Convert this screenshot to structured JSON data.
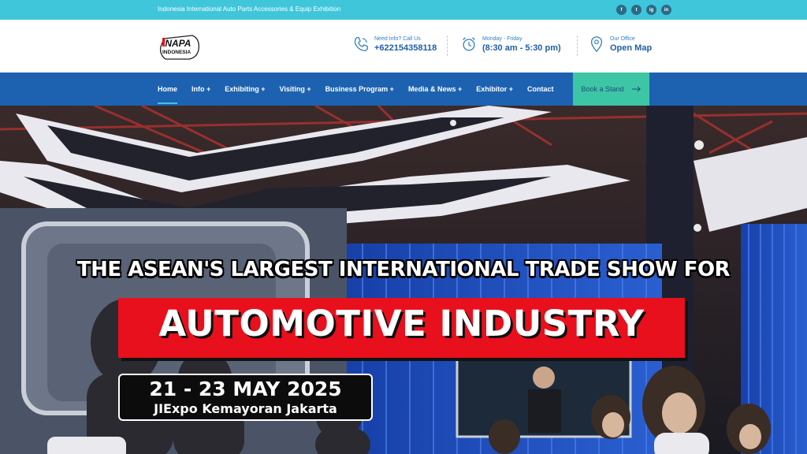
{
  "topbar": {
    "tagline": "Indonesia International Auto Parts Accessories & Equip Exhibition",
    "socials": [
      {
        "icon": "facebook-icon",
        "glyph": "f"
      },
      {
        "icon": "twitter-icon",
        "glyph": "t"
      },
      {
        "icon": "instagram-icon",
        "glyph": "ig"
      },
      {
        "icon": "linkedin-icon",
        "glyph": "in"
      }
    ]
  },
  "header": {
    "logo_alt": "INAPA INDONESIA",
    "logo_text_top": "INAPA",
    "logo_text_bottom": "INDONESIA",
    "call": {
      "label": "Need Info? Call Us",
      "value": "+622154358118",
      "icon": "phone-icon"
    },
    "hours": {
      "label": "Monday - Friday",
      "value": "(8:30 am - 5:30 pm)",
      "icon": "alarm-clock-icon"
    },
    "office": {
      "label": "Our Office",
      "value": "Open Map",
      "icon": "map-pin-icon"
    }
  },
  "nav": {
    "items": [
      "Home",
      "Info +",
      "Exhibiting +",
      "Visiting +",
      "Business Program +",
      "Media & News +",
      "Exhibitor +",
      "Contact"
    ],
    "active": "Home",
    "cta": "Book a Stand",
    "cta_icon": "arrow-right-icon"
  },
  "hero": {
    "line1": "THE ASEAN'S LARGEST INTERNATIONAL TRADE SHOW FOR",
    "line2": "AUTOMOTIVE INDUSTRY",
    "date": "21 - 23 MAY 2025",
    "venue": "JIExpo Kemayoran Jakarta"
  },
  "colors": {
    "topbar": "#3fc6db",
    "nav": "#1d62b0",
    "cta": "#3cc6a5",
    "headline_red": "#e8101c"
  }
}
